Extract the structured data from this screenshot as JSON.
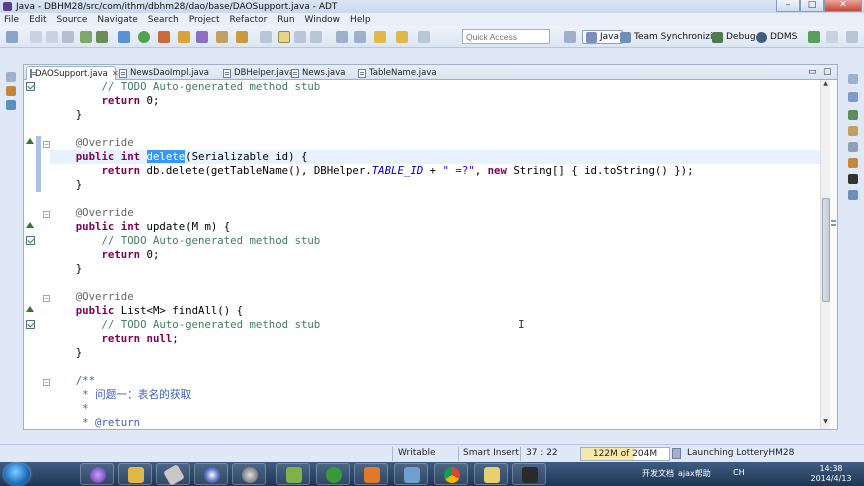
{
  "window": {
    "title": "Java - DBHM28/src/com/ithm/dbhm28/dao/base/DAOSupport.java - ADT"
  },
  "menu": [
    "File",
    "Edit",
    "Source",
    "Navigate",
    "Search",
    "Project",
    "Refactor",
    "Run",
    "Window",
    "Help"
  ],
  "toolbar": {
    "quick_access_placeholder": "Quick Access",
    "perspectives": [
      {
        "label": "Java",
        "active": true
      },
      {
        "label": "Team Synchronizing",
        "active": false
      },
      {
        "label": "Debug",
        "active": false
      },
      {
        "label": "DDMS",
        "active": false
      }
    ]
  },
  "editor": {
    "tabs": [
      {
        "label": "DAOSupport.java",
        "active": true
      },
      {
        "label": "NewsDaoImpl.java",
        "active": false
      },
      {
        "label": "DBHelper.java",
        "active": false
      },
      {
        "label": "News.java",
        "active": false
      },
      {
        "label": "TableName.java",
        "active": false
      }
    ],
    "code": {
      "l01": "        // TODO Auto-generated method stub",
      "l02_kw": "return",
      "l02_rest": " 0;",
      "l03": "    }",
      "l05": "    @Override",
      "l06_kw1": "public",
      "l06_kw2": "int",
      "l06_sel": "delete",
      "l06_rest": "(Serializable id) {",
      "l07_kw": "return",
      "l07_a": " db.delete(getTableName(), DBHelper.",
      "l07_fld": "TABLE_ID",
      "l07_b": " + ",
      "l07_str": "\" =?\"",
      "l07_c": ", ",
      "l07_kw2": "new",
      "l07_d": " String[] { id.toString() });",
      "l08": "    }",
      "l10": "    @Override",
      "l11_kw1": "public",
      "l11_kw2": "int",
      "l11_rest": " update(M m) {",
      "l12": "        // TODO Auto-generated method stub",
      "l13_kw": "return",
      "l13_rest": " 0;",
      "l14": "    }",
      "l16": "    @Override",
      "l17_kw": "public",
      "l17_rest": " List<M> findAll() {",
      "l18": "        // TODO Auto-generated method stub",
      "l19_kw": "return",
      "l19_kw2": "null",
      "l19_rest": ";",
      "l20": "    }",
      "l22": "    /**",
      "l23": "     * 问题一：表名的获取",
      "l24": "     *",
      "l25": "     * @return"
    }
  },
  "status": {
    "writable": "Writable",
    "insert_mode": "Smart Insert",
    "position": "37 : 22",
    "heap": "122M of 204M",
    "heap_used_fraction": 0.6,
    "task": "Launching LotteryHM28"
  },
  "taskbar": {
    "tray_label": "开发文档",
    "tray_app": "ajax帮助",
    "tray_ime": "CH",
    "time": "14:38",
    "date": "2014/4/13"
  },
  "colors": {
    "keyword": "#7f0055",
    "comment": "#3f7f5f",
    "annotation": "#646464",
    "javadoc": "#3f5fbf",
    "string": "#2a00ff",
    "selection": "#3399ff",
    "current_line": "#e8f2fe"
  }
}
